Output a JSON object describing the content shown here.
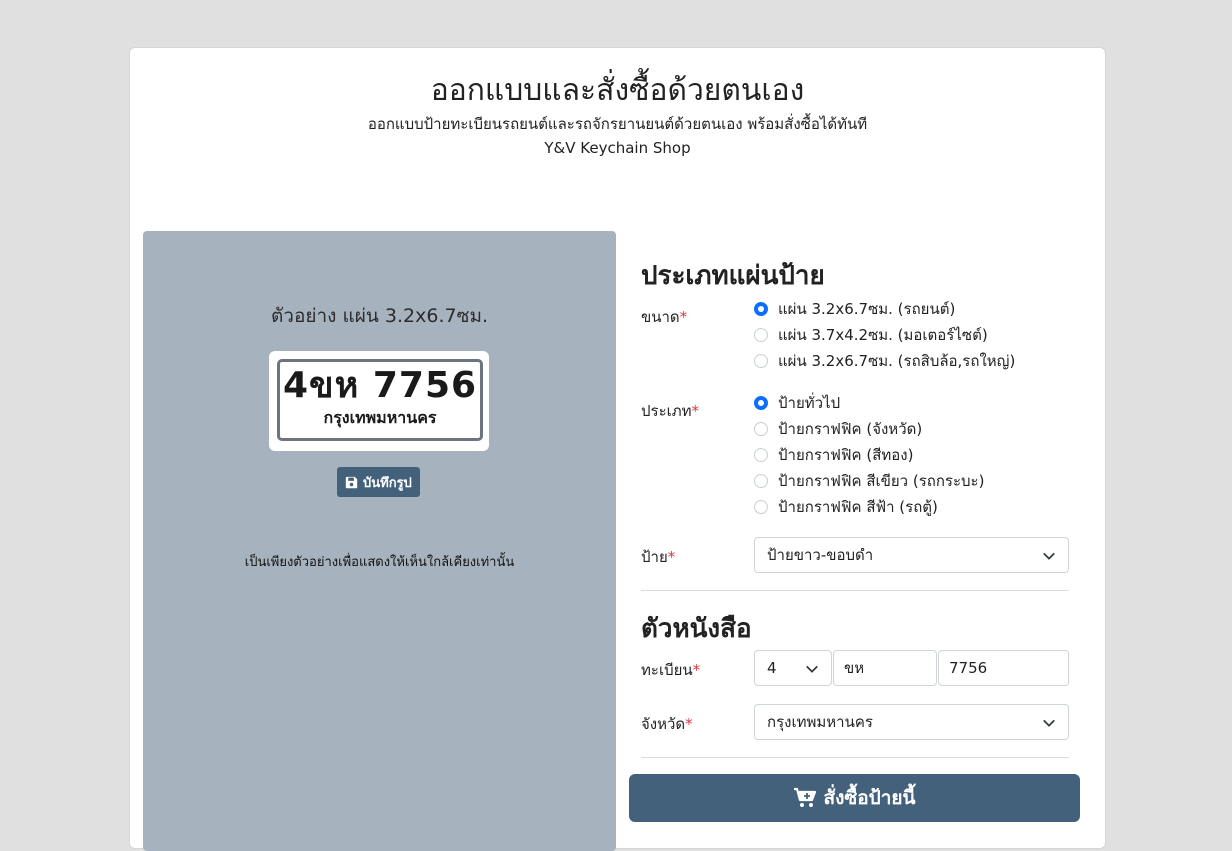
{
  "header": {
    "title": "ออกแบบและสั่งซื้อด้วยตนเอง",
    "subtitle": "ออกแบบป้ายทะเบียนรถยนต์และรถจักรยานยนต์ด้วยตนเอง พร้อมสั่งซื้อได้ทันที",
    "shop": "Y&V Keychain Shop"
  },
  "preview": {
    "title": "ตัวอย่าง แผ่น 3.2x6.7ซม.",
    "plate_number": "4ขห 7756",
    "plate_province": "กรุงเทพมหานคร",
    "save_label": "บันทึกรูป",
    "note": "เป็นเพียงตัวอย่างเพื่อแสดงให้เห็นใกล้เคียงเท่านั้น"
  },
  "form": {
    "section_plate": "ประเภทแผ่นป้าย",
    "size_label": "ขนาด",
    "size_options": [
      {
        "label": "แผ่น 3.2x6.7ซม. (รถยนต์)",
        "selected": true
      },
      {
        "label": "แผ่น 3.7x4.2ซม. (มอเตอร์ไซต์)",
        "selected": false
      },
      {
        "label": "แผ่น 3.2x6.7ซม. (รถสิบล้อ,รถใหญ่)",
        "selected": false
      }
    ],
    "type_label": "ประเภท",
    "type_options": [
      {
        "label": "ป้ายทั่วไป",
        "selected": true
      },
      {
        "label": "ป้ายกราฟฟิค (จังหวัด)",
        "selected": false
      },
      {
        "label": "ป้ายกราฟฟิค (สีทอง)",
        "selected": false
      },
      {
        "label": "ป้ายกราฟฟิค สีเขียว (รถกระบะ)",
        "selected": false
      },
      {
        "label": "ป้ายกราฟฟิค สีฟ้า (รถตู้)",
        "selected": false
      }
    ],
    "plate_label": "ป้าย",
    "plate_value": "ป้ายขาว-ขอบดำ",
    "section_letters": "ตัวหนังสือ",
    "reg_label": "ทะเบียน",
    "reg_prefix": "4",
    "reg_letters": "ขห",
    "reg_number": "7756",
    "province_label": "จังหวัด",
    "province_value": "กรุงเทพมหานคร",
    "required_mark": "*"
  },
  "order": {
    "label": "สั่งซื้อป้ายนี้"
  },
  "colors": {
    "accent": "#43617a",
    "radio": "#0d6efd",
    "required": "#dc3545",
    "preview_bg": "#a6b3bf"
  }
}
